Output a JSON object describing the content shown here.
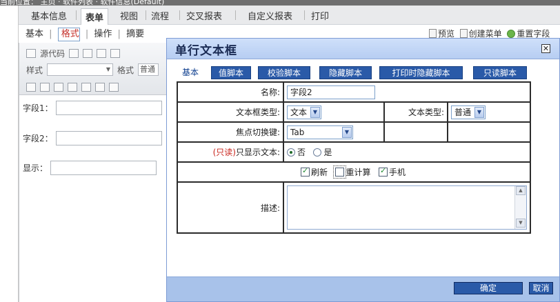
{
  "app": {
    "breadcrumb": "当前位置：  主页 · 软件列表 · 软件信息(Default)"
  },
  "tabs": [
    {
      "label": "基本信息"
    },
    {
      "label": "表单"
    },
    {
      "label": "视图"
    },
    {
      "label": "流程"
    },
    {
      "label": "交叉报表"
    },
    {
      "label": "自定义报表"
    },
    {
      "label": "打印"
    }
  ],
  "subtabs": {
    "items": [
      "基本",
      "格式",
      "操作",
      "摘要"
    ],
    "separator": "|"
  },
  "top_actions": {
    "preview": "预览",
    "create_menu": "创建菜单",
    "reset": "重置字段"
  },
  "toolbar": {
    "source": "源代码",
    "style_label": "样式",
    "format_label": "格式",
    "format_value": "普通"
  },
  "fields": [
    {
      "label": "字段1："
    },
    {
      "label": "字段2："
    },
    {
      "label": "显示："
    }
  ],
  "dialog": {
    "title": "单行文本框",
    "close": "⊠",
    "tabs": [
      "基本",
      "值脚本",
      "校验脚本",
      "隐藏脚本",
      "打印时隐藏脚本",
      "只读脚本"
    ],
    "form": {
      "name_label": "名称:",
      "name_value": "字段2",
      "textbox_type_label": "文本框类型:",
      "textbox_type_value": "文本",
      "text_type_label": "文本类型:",
      "text_type_value": "普通",
      "focus_key_label": "焦点切换键:",
      "focus_key_value": "Tab",
      "readonly_prefix": "(只读)",
      "readonly_label": "只显示文本:",
      "radio_no": "否",
      "radio_yes": "是",
      "refresh": "刷新",
      "recalc": "重计算",
      "mobile": "手机",
      "desc_label": "描述:"
    },
    "ok": "确定",
    "cancel": "取消"
  },
  "colors": {
    "tab_button": "#2a5aa8",
    "dialog_footer": "#a8c2ea",
    "dialog_title": "#b6cdf2",
    "readonly_red": "#c8241c"
  }
}
